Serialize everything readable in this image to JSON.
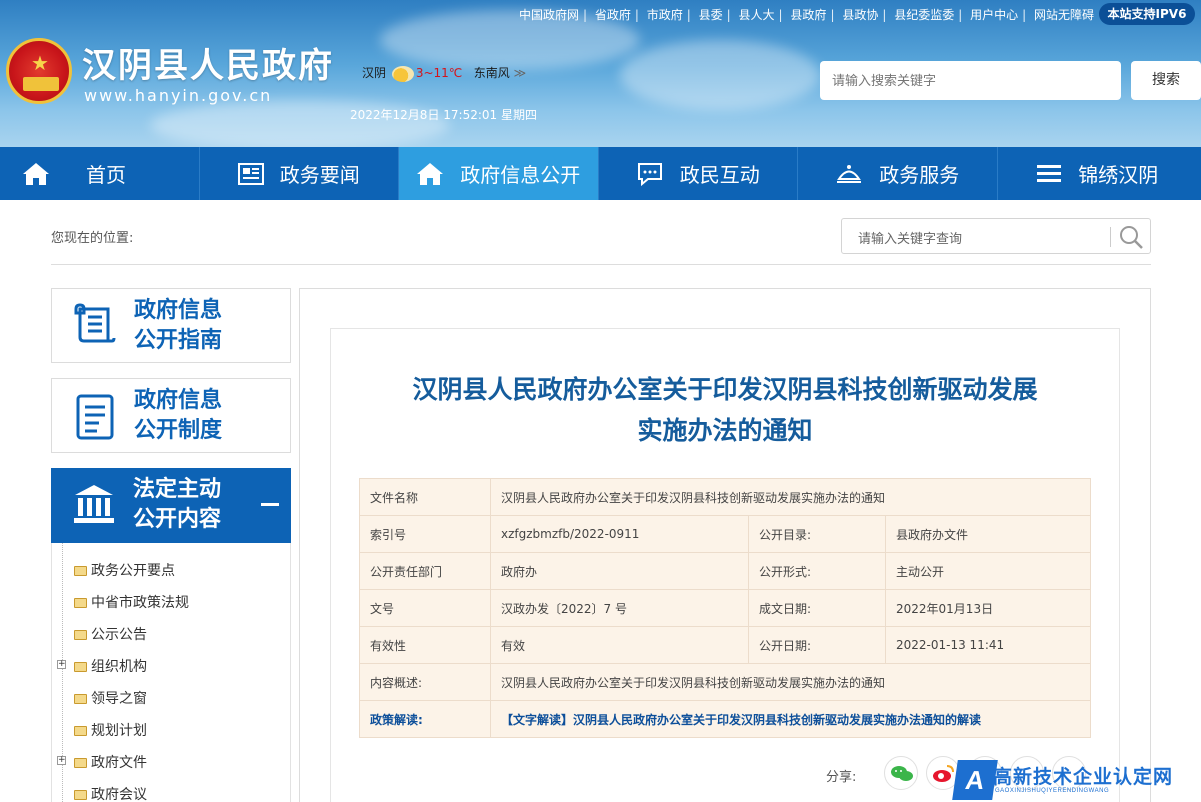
{
  "header": {
    "top_links": [
      "中国政府网",
      "省政府",
      "市政府",
      "县委",
      "县人大",
      "县政府",
      "县政协",
      "县纪委监委",
      "用户中心",
      "网站无障碍"
    ],
    "ipv6_badge": "本站支持IPV6",
    "site_title": "汉阴县人民政府",
    "site_url": "www.hanyin.gov.cn",
    "weather": {
      "city": "汉阴",
      "temp": "3~11℃",
      "wind": "东南风",
      "arrow": "≫"
    },
    "datetime": "2022年12月8日 17:52:01 星期四",
    "search_placeholder": "请输入搜索关键字",
    "search_button": "搜索"
  },
  "nav": {
    "items": [
      {
        "label": "首页",
        "icon": "home-icon"
      },
      {
        "label": "政务要闻",
        "icon": "news-icon"
      },
      {
        "label": "政府信息公开",
        "icon": "home-icon",
        "active": true
      },
      {
        "label": "政民互动",
        "icon": "chat-icon"
      },
      {
        "label": "政务服务",
        "icon": "service-icon"
      },
      {
        "label": "锦绣汉阴",
        "icon": "menu-icon"
      }
    ]
  },
  "location": {
    "label": "您现在的位置:",
    "search_placeholder": "请输入关键字查询"
  },
  "sidebar": {
    "guide": {
      "line1": "政府信息",
      "line2": "公开指南"
    },
    "system": {
      "line1": "政府信息",
      "line2": "公开制度"
    },
    "active": {
      "line1": "法定主动",
      "line2": "公开内容"
    },
    "tree": [
      "政务公开要点",
      "中省市政策法规",
      "公示公告",
      "组织机构",
      "领导之窗",
      "规划计划",
      "政府文件",
      "政府会议"
    ]
  },
  "article": {
    "title_line1": "汉阴县人民政府办公室关于印发汉阴县科技创新驱动发展",
    "title_line2": "实施办法的通知",
    "info": {
      "doc_name_label": "文件名称",
      "doc_name": "汉阴县人民政府办公室关于印发汉阴县科技创新驱动发展实施办法的通知",
      "index_label": "索引号",
      "index": "xzfgzbmzfb/2022-0911",
      "catalog_label": "公开目录:",
      "catalog": "县政府办文件",
      "dept_label": "公开责任部门",
      "dept": "政府办",
      "form_label": "公开形式:",
      "form": "主动公开",
      "docno_label": "文号",
      "docno": "汉政办发〔2022〕7 号",
      "made_label": "成文日期:",
      "made": "2022年01月13日",
      "valid_label": "有效性",
      "valid": "有效",
      "pub_label": "公开日期:",
      "pub": "2022-01-13 11:41",
      "summary_label": "内容概述:",
      "summary": "汉阴县人民政府办公室关于印发汉阴县科技创新驱动发展实施办法的通知",
      "policy_label": "政策解读:",
      "policy": "【文字解读】汉阴县人民政府办公室关于印发汉阴县科技创新驱动发展实施办法通知的解读"
    },
    "share_label": "分享:"
  },
  "watermark": {
    "logo": "A",
    "text": "高新技术企业认定网",
    "sub": "GAOXINJISHUQIYERENDINGWANG"
  },
  "colors": {
    "nav_bg": "#0d63b5",
    "nav_active": "#2e9ee0",
    "title_blue": "#155c9c",
    "table_bg": "#fcf3e8",
    "ipv6_bg": "#0b4f97"
  }
}
